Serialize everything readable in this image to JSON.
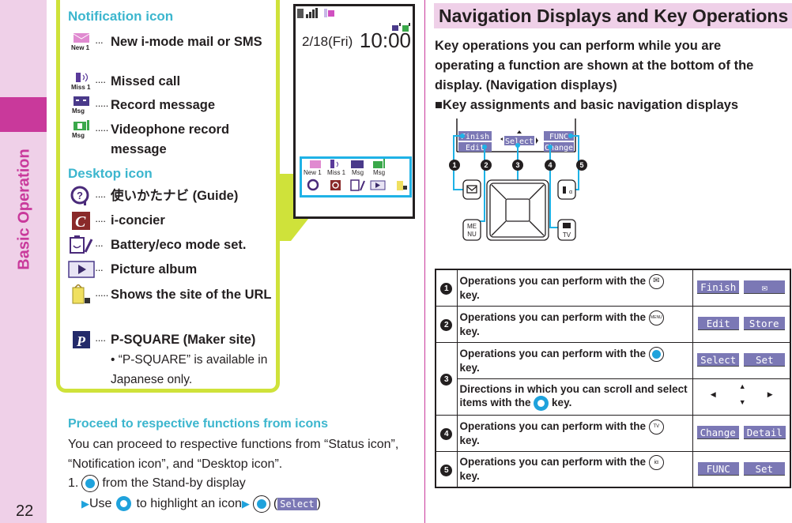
{
  "sidebar": {
    "section_label": "Basic Operation",
    "page_number": "22"
  },
  "notification": {
    "title": "Notification icon",
    "items": [
      {
        "icon": "new-mail-icon",
        "icon_caption": "New 1",
        "dots": "···",
        "label": "New i-mode mail or SMS"
      },
      {
        "icon": "missed-call-icon",
        "icon_caption": "Miss 1",
        "dots": "····",
        "label": "Missed call"
      },
      {
        "icon": "record-message-icon",
        "icon_caption": "Msg",
        "dots": "·····",
        "label": "Record message"
      },
      {
        "icon": "videophone-record-icon",
        "icon_caption": "Msg",
        "dots": "·····",
        "label": "Videophone record message"
      }
    ]
  },
  "desktop": {
    "title": "Desktop icon",
    "items": [
      {
        "icon": "guide-icon",
        "dots": "····",
        "label": "使いかたナビ (Guide)"
      },
      {
        "icon": "i-concier-icon",
        "dots": "····",
        "label": "i-concier"
      },
      {
        "icon": "battery-eco-icon",
        "dots": "···",
        "label": "Battery/eco mode set."
      },
      {
        "icon": "picture-album-icon",
        "dots": "···",
        "label": "Picture album"
      },
      {
        "icon": "url-site-icon",
        "dots": "·····",
        "label": "Shows the site of the URL"
      },
      {
        "icon": "p-square-icon",
        "dots": "····",
        "label": "P-SQUARE (Maker site)"
      }
    ],
    "note": "• “P-SQUARE” is available in Japanese only."
  },
  "phone": {
    "date": "2/18(Fri)",
    "time": "10:00",
    "panel_captions": [
      "New 1",
      "Miss 1",
      "Msg",
      "Msg"
    ]
  },
  "proceed": {
    "title": "Proceed to respective functions from icons",
    "body": "You can proceed to respective functions from “Status icon”, “Notification icon”, and “Desktop icon”.",
    "step1_num": "1.",
    "step1_text": "from the Stand-by display",
    "step2_use": "Use",
    "step2_text": "to highlight an icon",
    "step2_paren_open": "(",
    "step2_key": "Select",
    "step2_paren_close": ")"
  },
  "nav": {
    "heading": "Navigation Displays and Key Operations",
    "intro": "Key operations you can perform while you are operating a function are shown at the bottom of the display. (Navigation displays)",
    "subhead": "■Key assignments and basic navigation displays",
    "diagram": {
      "softkeys": [
        "Finish",
        "Edit",
        "Select",
        "FUNC",
        "Change"
      ],
      "callouts": [
        "1",
        "2",
        "3",
        "4",
        "5"
      ],
      "keys": {
        "mail": "✉",
        "menu_top": "ME",
        "menu_bottom": "NU",
        "tv": "TV"
      }
    },
    "table": {
      "rows": [
        {
          "num": "1",
          "desc_pre": "Operations you can perform with the",
          "key": "mail-key",
          "key_glyph": "✉",
          "desc_post": "key.",
          "softkeys": [
            "Finish",
            "✉"
          ]
        },
        {
          "num": "2",
          "desc_pre": "Operations you can perform with the",
          "key": "menu-key",
          "key_glyph": "MENU",
          "desc_post": "key.",
          "softkeys": [
            "Edit",
            "Store"
          ]
        },
        {
          "num": "3",
          "desc_pre": "Operations you can perform with the",
          "key": "enter-key",
          "key_glyph": "",
          "desc_post": "key.",
          "softkeys": [
            "Select",
            "Set"
          ]
        },
        {
          "num": "",
          "desc_pre": "Directions in which you can scroll and select items with the",
          "key": "multi-key",
          "key_glyph": "",
          "desc_post": "key.",
          "arrows": [
            "▲",
            "◀",
            "▶",
            "▼"
          ]
        },
        {
          "num": "4",
          "desc_pre": "Operations you can perform with the",
          "key": "camera-tv-key",
          "key_glyph": "TV",
          "desc_post": "key.",
          "softkeys": [
            "Change",
            "Detail"
          ]
        },
        {
          "num": "5",
          "desc_pre": "Operations you can perform with the",
          "key": "i-appli-key",
          "key_glyph": "iα",
          "desc_post": "key.",
          "softkeys": [
            "FUNC",
            "Set"
          ]
        }
      ]
    }
  },
  "colors": {
    "accent_pink": "#c9399b",
    "pink_bg": "#efd0e8",
    "callout_green": "#cfe23a",
    "cyan": "#3cb6ce",
    "blue": "#1fb2e6",
    "softkey": "#7b78b5"
  }
}
